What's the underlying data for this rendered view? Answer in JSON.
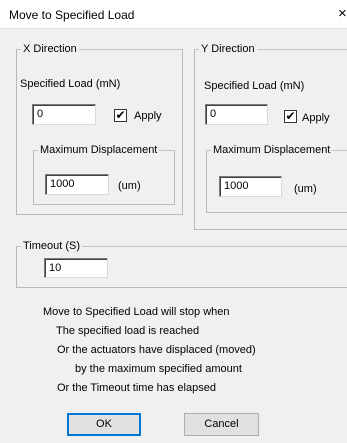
{
  "window": {
    "title": "Move to Specified Load",
    "close_glyph": "×"
  },
  "x_direction": {
    "legend": "X Direction",
    "load_label": "Specified Load (mN)",
    "load_value": "0",
    "apply_label": "Apply",
    "apply_checked": true,
    "max_disp_legend": "Maximum Displacement",
    "max_disp_value": "1000",
    "unit": "(um)"
  },
  "y_direction": {
    "legend": "Y Direction",
    "load_label": "Specified Load (mN)",
    "load_value": "0",
    "apply_label": "Apply",
    "apply_checked": true,
    "max_disp_legend": "Maximum Displacement",
    "max_disp_value": "1000",
    "unit": "(um)"
  },
  "timeout": {
    "legend": "Timeout (S)",
    "value": "10"
  },
  "info": {
    "line1": "Move to Specified Load will stop when",
    "line2": "The specified load is reached",
    "line3": "Or the actuators have displaced (moved)",
    "line4": "by the maximum specified amount",
    "line5": "Or the Timeout time has elapsed"
  },
  "buttons": {
    "ok": "OK",
    "cancel": "Cancel"
  },
  "icons": {
    "checkmark": "check-icon",
    "close": "close-icon"
  }
}
